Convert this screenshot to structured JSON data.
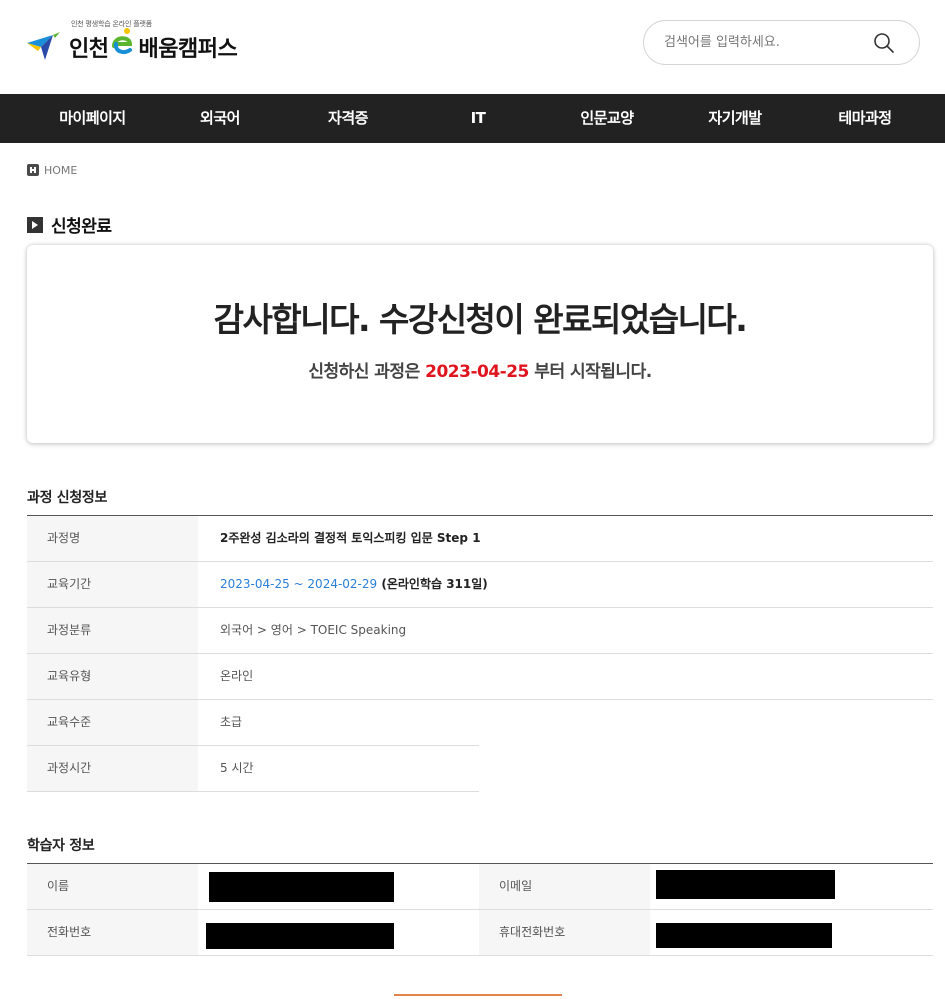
{
  "header": {
    "logo_tagline": "인천 평생학습 온라인 플랫폼",
    "logo_text_a": "인천",
    "logo_text_b": "배움캠퍼스",
    "search": {
      "placeholder": "검색어를 입력하세요."
    }
  },
  "nav": {
    "items": [
      {
        "label": "마이페이지"
      },
      {
        "label": "외국어"
      },
      {
        "label": "자격증"
      },
      {
        "label": "IT"
      },
      {
        "label": "인문교양"
      },
      {
        "label": "자기개발"
      },
      {
        "label": "테마과정"
      }
    ]
  },
  "breadcrumb": {
    "home": "HOME"
  },
  "page": {
    "title": "신청완료",
    "complete_title": "감사합니다. 수강신청이 완료되었습니다.",
    "complete_sub_prefix": "신청하신 과정은 ",
    "complete_sub_date": "2023-04-25",
    "complete_sub_suffix": " 부터 시작됩니다."
  },
  "course_info": {
    "heading": "과정 신청정보",
    "course_name_label": "과정명",
    "course_name": "2주완성 김소라의 결정적 토익스피킹 입문 Step 1",
    "period_label": "교육기간",
    "period_dates": "2023-04-25 ~ 2024-02-29",
    "period_note": " (온라인학습 311일)",
    "category_label": "과정분류",
    "category": "외국어 > 영어 > TOEIC Speaking",
    "type_label": "교육유형",
    "type": "온라인",
    "level_label": "교육수준",
    "level": "초급",
    "hours_label": "과정시간",
    "hours": "5 시간"
  },
  "learner_info": {
    "heading": "학습자 정보",
    "name_label": "이름",
    "email_label": "이메일",
    "phone_label": "전화번호",
    "mobile_label": "휴대전화번호"
  },
  "colors": {
    "nav_bg": "#222222",
    "highlight_red": "#e0141e",
    "link_blue": "#2b7fd6",
    "logo_blue": "#1a8fd9",
    "logo_yellow": "#f4c400",
    "logo_green": "#5cb531",
    "button_orange": "#e2844a"
  }
}
